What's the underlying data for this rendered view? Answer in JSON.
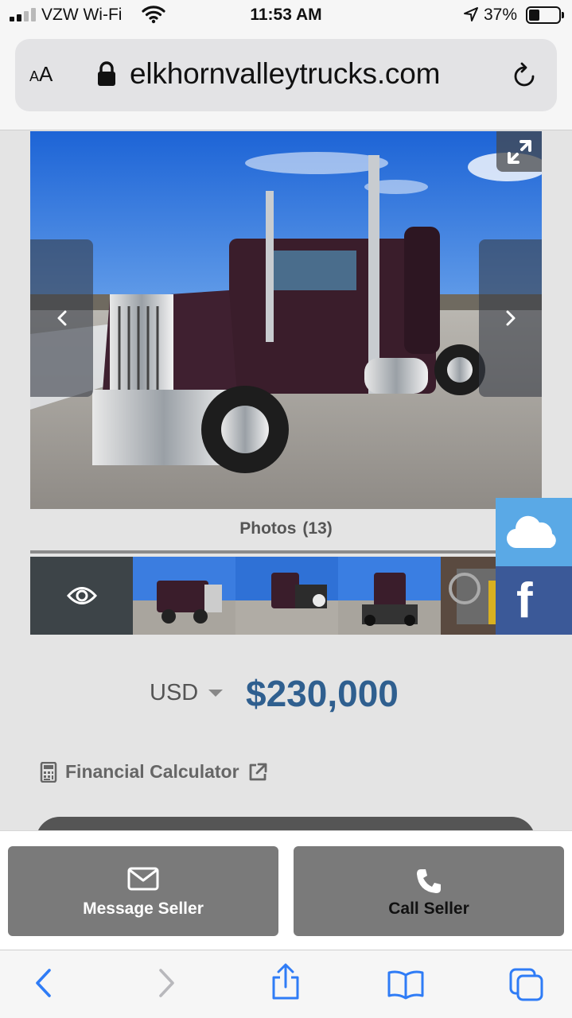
{
  "status_bar": {
    "carrier": "VZW Wi-Fi",
    "time": "11:53 AM",
    "battery_percent": "37%",
    "battery_level": 0.37,
    "signal_bars": 2
  },
  "browser": {
    "text_size_button": {
      "big": "A",
      "small": "A"
    },
    "url": "elkhornvalleytrucks.com",
    "icons": [
      "lock-icon",
      "reload-icon"
    ]
  },
  "gallery": {
    "photos_label": "Photos",
    "photos_count": "(13)",
    "icons": [
      "expand-icon",
      "chevron-left-icon",
      "chevron-right-icon",
      "eye-icon"
    ],
    "thumbnail_count_visible": 5
  },
  "social": {
    "cloud_icon": "cloud-icon",
    "facebook_letter": "f"
  },
  "pricing": {
    "currency": "USD",
    "price": "$230,000"
  },
  "financial_calculator": {
    "label": "Financial Calculator",
    "icons": [
      "calculator-icon",
      "external-link-icon"
    ]
  },
  "actions": {
    "message_label": "Message Seller",
    "call_label": "Call Seller",
    "icons": [
      "envelope-icon",
      "phone-icon"
    ]
  },
  "toolbar": {
    "icons": [
      "back-icon",
      "forward-icon",
      "share-icon",
      "bookmarks-icon",
      "tabs-icon"
    ]
  },
  "colors": {
    "price": "#2f5f8f",
    "facebook": "#3b5998",
    "cloud_badge": "#5aa9e6",
    "action_button": "#7a7a7a",
    "ios_blue": "#2f7cf6"
  }
}
